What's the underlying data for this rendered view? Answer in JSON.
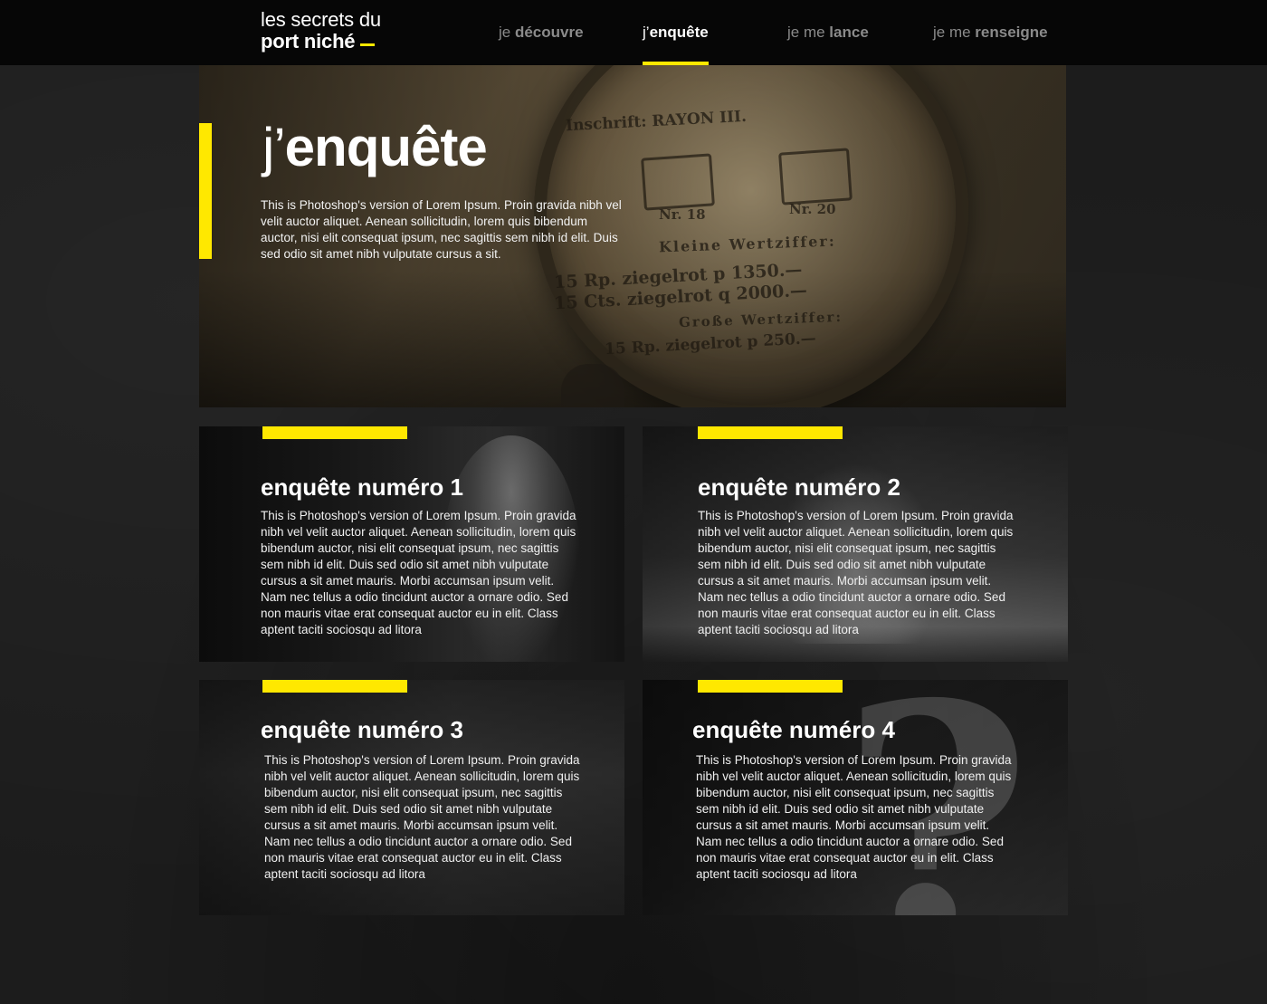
{
  "header": {
    "logo_line1": "les secrets du",
    "logo_line2": "port niché",
    "nav": [
      {
        "prefix": "je ",
        "bold": "découvre",
        "active": false
      },
      {
        "prefix": "j’",
        "bold": "enquête",
        "active": true
      },
      {
        "prefix": "je me ",
        "bold": "lance",
        "active": false
      },
      {
        "prefix": "je me ",
        "bold": "renseigne",
        "active": false
      }
    ]
  },
  "hero": {
    "title_prefix": "j’",
    "title_bold": "enquête",
    "text": "This is Photoshop's version  of Lorem Ipsum. Proin gravida nibh vel velit auctor aliquet. Aenean sollicitudin, lorem quis bibendum auctor, nisi elit consequat ipsum, nec sagittis sem nibh id elit. Duis sed odio sit amet nibh vulputate cursus a sit.",
    "image_text": {
      "line1": "Inschrift: RAYON III.",
      "stamp1_label": "Nr. 18",
      "stamp2_label": "Nr. 20",
      "line2": "Kleine Wertziffer:",
      "line3": "15 Rp. ziegelrot   p 1350.—",
      "line4": "15 Cts. ziegelrot   q 2000.—",
      "line5": "Große Wertziffer:",
      "line6": "15 Rp. ziegelrot   p 250.—"
    }
  },
  "cards": [
    {
      "title_prefix": "enquête ",
      "title_bold": "numéro 1",
      "text": "This is Photoshop's version  of Lorem Ipsum. Proin gravida nibh vel velit auctor aliquet. Aenean sollicitudin, lorem quis bibendum auctor, nisi elit consequat ipsum, nec sagittis sem nibh id elit. Duis sed odio sit amet nibh vulputate cursus a sit amet mauris. Morbi accumsan ipsum velit. Nam nec tellus a odio tincidunt auctor a ornare odio. Sed non  mauris vitae erat consequat auctor eu in elit. Class aptent taciti sociosqu ad litora"
    },
    {
      "title_prefix": "enquête ",
      "title_bold": "numéro 2",
      "text": "This is Photoshop's version  of Lorem Ipsum. Proin gravida nibh vel velit auctor aliquet. Aenean sollicitudin, lorem quis bibendum auctor, nisi elit consequat ipsum, nec sagittis sem nibh id elit. Duis sed odio sit amet nibh vulputate cursus a sit amet mauris. Morbi accumsan ipsum velit. Nam nec tellus a odio tincidunt auctor a ornare odio. Sed non  mauris vitae erat consequat auctor eu in elit. Class aptent taciti sociosqu ad litora"
    },
    {
      "title_prefix": "enquête ",
      "title_bold": "numéro 3",
      "text": "This is Photoshop's version  of Lorem Ipsum. Proin gravida nibh vel velit auctor aliquet. Aenean sollicitudin, lorem quis bibendum auctor, nisi elit consequat ipsum, nec sagittis sem nibh id elit. Duis sed odio sit amet nibh vulputate cursus a sit amet mauris. Morbi accumsan ipsum velit. Nam nec tellus a odio tincidunt auctor a ornare odio. Sed non  mauris vitae erat consequat auctor eu in elit. Class aptent taciti sociosqu ad litora"
    },
    {
      "title_prefix": "enquête ",
      "title_bold": "numéro 4",
      "text": "This is Photoshop's version  of Lorem Ipsum. Proin gravida nibh vel velit auctor aliquet. Aenean sollicitudin, lorem quis bibendum auctor, nisi elit consequat ipsum, nec sagittis sem nibh id elit. Duis sed odio sit amet nibh vulputate cursus a sit amet mauris. Morbi accumsan ipsum velit. Nam nec tellus a odio tincidunt auctor a ornare odio. Sed non  mauris vitae erat consequat auctor eu in elit. Class aptent taciti sociosqu ad litora"
    }
  ],
  "colors": {
    "accent": "#ffe800",
    "header_bg": "#060606",
    "page_bg": "#1c1c1c",
    "nav_inactive": "#8a8a8a"
  }
}
